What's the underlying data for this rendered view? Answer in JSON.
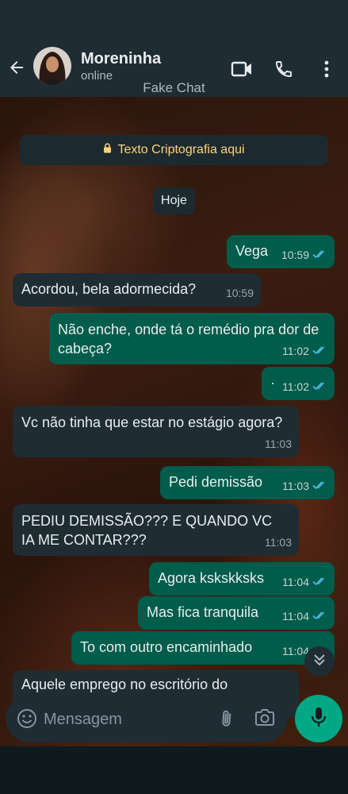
{
  "header": {
    "contact_name": "Moreninha",
    "status": "online",
    "watermark": "Fake Chat"
  },
  "chat": {
    "encryption_notice": "Texto Criptografia aqui",
    "date_label": "Hoje",
    "messages": [
      {
        "direction": "out",
        "text": "Vega",
        "time": "10:59",
        "ticks": "read"
      },
      {
        "direction": "in",
        "text": "Acordou, bela adormecida?",
        "time": "10:59"
      },
      {
        "direction": "out",
        "text": "Não enche, onde tá o remédio pra dor de cabeça?",
        "time": "11:02",
        "ticks": "read"
      },
      {
        "direction": "out",
        "text": "·",
        "time": "11:02",
        "ticks": "read"
      },
      {
        "direction": "in",
        "text": "Vc não tinha que estar no estágio agora?",
        "time": "11:03"
      },
      {
        "direction": "out",
        "text": "Pedi demissão",
        "time": "11:03",
        "ticks": "read"
      },
      {
        "direction": "in",
        "text": "PEDIU DEMISSÃO??? E QUANDO VC IA ME CONTAR???",
        "time": "11:03"
      },
      {
        "direction": "out",
        "text": "Agora kskskksks",
        "time": "11:04",
        "ticks": "read"
      },
      {
        "direction": "out",
        "text": "Mas fica tranquila",
        "time": "11:04",
        "ticks": "read"
      },
      {
        "direction": "out",
        "text": "To com outro encaminhado",
        "time": "11:04",
        "ticks": "read"
      },
      {
        "direction": "in",
        "text": "Aquele emprego no escritório do",
        "time": ""
      }
    ]
  },
  "composer": {
    "placeholder": "Mensagem"
  },
  "colors": {
    "header_bg": "#1f2c33",
    "outgoing_bubble": "#005c4b",
    "incoming_bubble": "#1f2c33",
    "accent": "#00a884",
    "read_ticks": "#53bdeb",
    "encryption_text": "#ffd279"
  },
  "icons": [
    "back-arrow-icon",
    "video-call-icon",
    "phone-icon",
    "more-options-icon",
    "lock-icon",
    "double-check-icon",
    "chevron-double-down-icon",
    "emoji-icon",
    "attach-icon",
    "camera-icon",
    "mic-icon"
  ]
}
